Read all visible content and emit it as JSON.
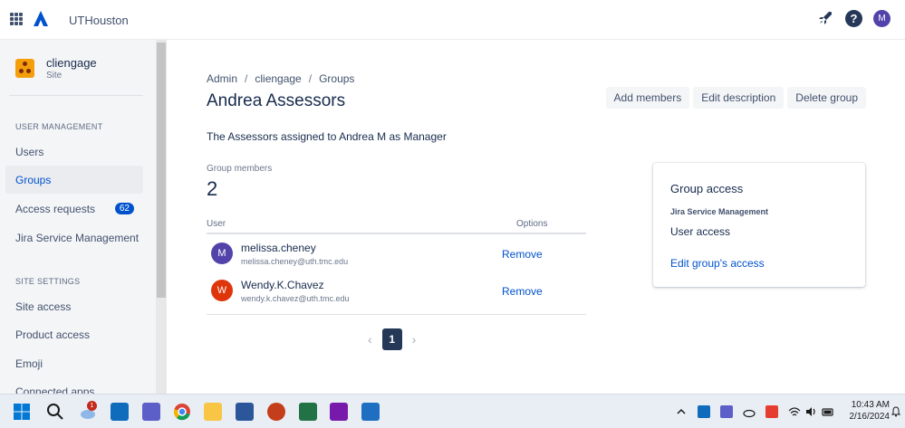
{
  "topbar": {
    "org_name": "UTHouston",
    "user_initial": "M",
    "help_label": "?"
  },
  "sidebar": {
    "site": {
      "name": "cliengage",
      "type": "Site"
    },
    "user_management_title": "USER MANAGEMENT",
    "user_items": [
      {
        "label": "Users"
      },
      {
        "label": "Groups",
        "active": true
      },
      {
        "label": "Access requests",
        "badge": "62"
      },
      {
        "label": "Jira Service Management"
      }
    ],
    "site_settings_title": "SITE SETTINGS",
    "settings_items": [
      {
        "label": "Site access"
      },
      {
        "label": "Product access"
      },
      {
        "label": "Emoji"
      },
      {
        "label": "Connected apps"
      }
    ]
  },
  "breadcrumb": [
    "Admin",
    "cliengage",
    "Groups"
  ],
  "page": {
    "title": "Andrea Assessors",
    "description": "The Assessors assigned to Andrea M as Manager",
    "actions": {
      "add_members": "Add members",
      "edit_description": "Edit description",
      "delete_group": "Delete group"
    }
  },
  "members": {
    "label": "Group members",
    "count": "2",
    "columns": {
      "user": "User",
      "options": "Options"
    },
    "rows": [
      {
        "initial": "M",
        "name": "melissa.cheney",
        "email": "melissa.cheney@uth.tmc.edu",
        "action": "Remove",
        "color": "#5243aa"
      },
      {
        "initial": "W",
        "name": "Wendy.K.Chavez",
        "email": "wendy.k.chavez@uth.tmc.edu",
        "action": "Remove",
        "color": "#de350b"
      }
    ]
  },
  "pagination": {
    "current": "1",
    "prev": "‹",
    "next": "›"
  },
  "group_access": {
    "title": "Group access",
    "product": "Jira Service Management",
    "level": "User access",
    "edit_link": "Edit group's access"
  },
  "taskbar": {
    "teams_badge": "1",
    "time": "10:43 AM",
    "date": "2/16/2024"
  },
  "colors": {
    "primary": "#0052cc",
    "text": "#172b4d",
    "sidebar_bg": "#f4f5f7",
    "pager_active": "#253858"
  }
}
